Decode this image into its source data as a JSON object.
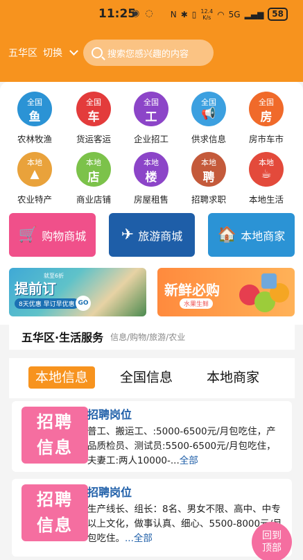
{
  "status_bar": {
    "time": "11:25",
    "net_speed_value": "12.4",
    "net_speed_unit": "K/s",
    "signal": "5G",
    "battery": "58"
  },
  "header": {
    "location": "五华区",
    "switch_label": "切换",
    "search_placeholder": "搜索您感兴趣的内容",
    "colors": {
      "brand": "#f7931e",
      "pink": "#f56ea0",
      "link": "#1e5ea8"
    }
  },
  "categories": [
    {
      "tag": "全国",
      "glyph": "鱼",
      "label": "农林牧渔",
      "color": "#2b93d5",
      "icon": "fish-icon"
    },
    {
      "tag": "全国",
      "glyph": "车",
      "label": "货运客运",
      "color": "#e33b3b",
      "icon": "truck-icon"
    },
    {
      "tag": "全国",
      "glyph": "工",
      "label": "企业招工",
      "color": "#8c45c8",
      "icon": "worker-icon"
    },
    {
      "tag": "全国",
      "glyph": "📢",
      "label": "供求信息",
      "color": "#3ca0e0",
      "icon": "megaphone-icon"
    },
    {
      "tag": "全国",
      "glyph": "房",
      "label": "房市车市",
      "color": "#f06a2a",
      "icon": "house-icon"
    },
    {
      "tag": "本地",
      "glyph": "▲",
      "label": "农业特产",
      "color": "#e9a23b",
      "icon": "farm-icon"
    },
    {
      "tag": "本地",
      "glyph": "店",
      "label": "商业店铺",
      "color": "#7cc24a",
      "icon": "shop-icon"
    },
    {
      "tag": "本地",
      "glyph": "楼",
      "label": "房屋租售",
      "color": "#8c45c8",
      "icon": "building-icon"
    },
    {
      "tag": "本地",
      "glyph": "聘",
      "label": "招聘求职",
      "color": "#c45a3b",
      "icon": "hire-icon"
    },
    {
      "tag": "本地",
      "glyph": "☕",
      "label": "本地生活",
      "color": "#e34a3b",
      "icon": "cup-icon"
    }
  ],
  "big_buttons": [
    {
      "label": "购物商城",
      "color": "#f0508a",
      "icon": "cart-icon",
      "glyph": "🛒"
    },
    {
      "label": "旅游商城",
      "color": "#1e5ea8",
      "icon": "plane-icon",
      "glyph": "✈"
    },
    {
      "label": "本地商家",
      "color": "#2b93d5",
      "icon": "store-icon",
      "glyph": "🏠"
    }
  ],
  "banners": {
    "left": {
      "tag": "就至6折",
      "title": "提前订",
      "sub": "8天优惠 早订早优惠",
      "go": "GO"
    },
    "right": {
      "title": "新鲜必购",
      "sub": "水果生鲜"
    }
  },
  "service": {
    "title": "五华区·生活服务",
    "subtitle": "信息/购物/旅游/农业"
  },
  "tabs": [
    {
      "label": "本地信息",
      "active": true
    },
    {
      "label": "全国信息",
      "active": false
    },
    {
      "label": "本地商家",
      "active": false
    }
  ],
  "listings": [
    {
      "thumb_line1": "招聘",
      "thumb_line2": "信息",
      "title": "招聘岗位",
      "desc": "普工、搬运工、:5000-6500元/月包吃住，产品质检员、测试员:5500-6500元/月包吃住，夫妻工:两人10000-...",
      "more": "全部"
    },
    {
      "thumb_line1": "招聘",
      "thumb_line2": "信息",
      "title": "招聘岗位",
      "desc": "生产线长、组长：8名、男女不限、高中、中专以上文化，做事认真、细心、5500-8000元/月包吃住。",
      "more": "...全部"
    }
  ],
  "back_top": {
    "line1": "回到",
    "line2": "顶部"
  }
}
